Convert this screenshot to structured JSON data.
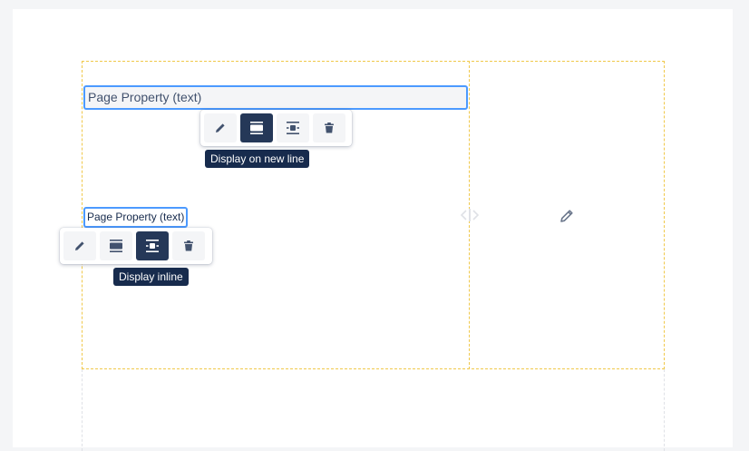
{
  "colors": {
    "accent": "#4c9aff",
    "section_border": "#f0c84a",
    "tooltip_bg": "#172b4d",
    "active_button": "#253858"
  },
  "macros": {
    "block": {
      "label": "Page Property (text)"
    },
    "inline": {
      "label": "Page Property (text)"
    }
  },
  "toolbar_block": {
    "buttons": [
      "pencil-icon",
      "display-block-icon",
      "display-inline-icon",
      "trash-icon"
    ],
    "active": "display-block-icon",
    "tooltip": "Display on new line"
  },
  "toolbar_inline": {
    "buttons": [
      "pencil-icon",
      "display-block-icon",
      "display-inline-icon",
      "trash-icon"
    ],
    "active": "display-inline-icon",
    "tooltip": "Display inline"
  },
  "column_icons": [
    "resize-handle-icon",
    "edit-pencil-icon"
  ]
}
